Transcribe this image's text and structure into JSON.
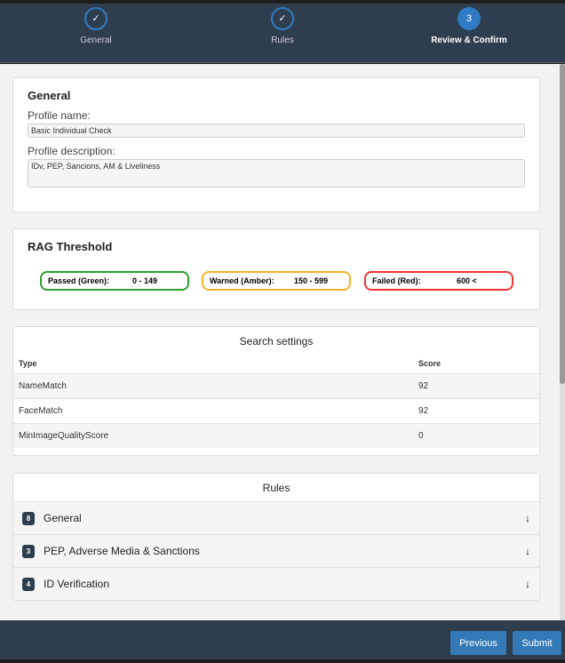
{
  "steps": [
    {
      "label": "General",
      "mark": "✓"
    },
    {
      "label": "Rules",
      "mark": "✓"
    },
    {
      "label": "Review & Confirm",
      "mark": "3"
    }
  ],
  "general": {
    "title": "General",
    "name_label": "Profile name:",
    "name_value": "Basic Individual Check",
    "desc_label": "Profile description:",
    "desc_value": "IDv, PEP, Sancions, AM & Liveliness"
  },
  "rag": {
    "title": "RAG Threshold",
    "items": [
      {
        "label": "Passed (Green):",
        "range": "0 - 149",
        "color": "#2e9e2e"
      },
      {
        "label": "Warned (Amber):",
        "range": "150 - 599",
        "color": "#f5b22a"
      },
      {
        "label": "Failed (Red):",
        "range": "600 <",
        "color": "#ee3333"
      }
    ]
  },
  "search": {
    "title": "Search settings",
    "headers": [
      "Type",
      "Score"
    ],
    "rows": [
      [
        "NameMatch",
        "92"
      ],
      [
        "FaceMatch",
        "92"
      ],
      [
        "MinImageQualityScore",
        "0"
      ]
    ]
  },
  "rules": {
    "title": "Rules",
    "items": [
      {
        "count": "8",
        "label": "General"
      },
      {
        "count": "3",
        "label": "PEP, Adverse Media & Sanctions"
      },
      {
        "count": "4",
        "label": "ID Verification"
      }
    ]
  },
  "footer": {
    "previous": "Previous",
    "submit": "Submit"
  }
}
